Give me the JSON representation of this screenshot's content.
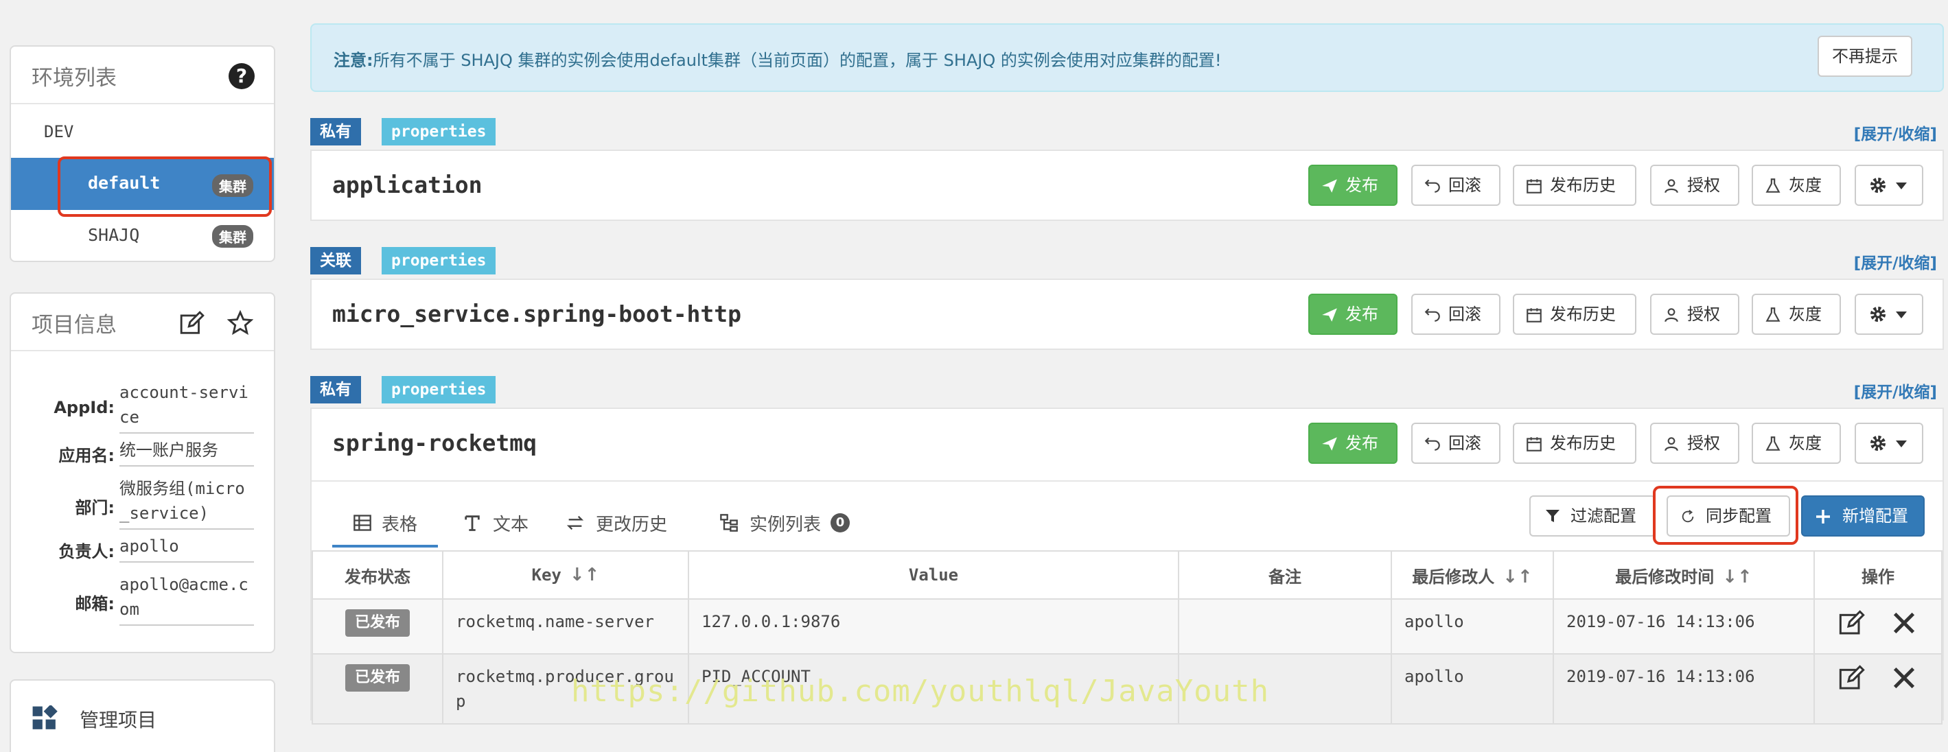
{
  "sidebar": {
    "env_title": "环境列表",
    "env_name": "DEV",
    "clusters": [
      {
        "name": "default",
        "badge": "集群"
      },
      {
        "name": "SHAJQ",
        "badge": "集群"
      }
    ],
    "info_title": "项目信息",
    "info": [
      {
        "label": "AppId:",
        "value": "account-service"
      },
      {
        "label": "应用名:",
        "value": "统一账户服务"
      },
      {
        "label": "部门:",
        "value": "微服务组(micro_service)"
      },
      {
        "label": "负责人:",
        "value": "apollo"
      },
      {
        "label": "邮箱:",
        "value": "apollo@acme.com"
      }
    ],
    "manage_label": "管理项目"
  },
  "notice": {
    "prefix": "注意:",
    "text": "所有不属于 SHAJQ 集群的实例会使用default集群（当前页面）的配置，属于 SHAJQ 的实例会使用对应集群的配置!",
    "dismiss": "不再提示"
  },
  "toggle_label": "[展开/收缩]",
  "actions": {
    "publish": "发布",
    "rollback": "回滚",
    "history": "发布历史",
    "grant": "授权",
    "gray": "灰度"
  },
  "namespaces": [
    {
      "scope": "私有",
      "format": "properties",
      "name": "application"
    },
    {
      "scope": "关联",
      "format": "properties",
      "name": "micro_service.spring-boot-http"
    },
    {
      "scope": "私有",
      "format": "properties",
      "name": "spring-rocketmq"
    }
  ],
  "tabs": {
    "table": "表格",
    "text": "文本",
    "history": "更改历史",
    "instances": "实例列表",
    "instances_count": "0"
  },
  "table_buttons": {
    "filter": "过滤配置",
    "sync": "同步配置",
    "add": "新增配置"
  },
  "table": {
    "headers": {
      "status": "发布状态",
      "key": "Key",
      "value": "Value",
      "comment": "备注",
      "modifier": "最后修改人",
      "time": "最后修改时间",
      "ops": "操作"
    },
    "rows": [
      {
        "status": "已发布",
        "key": "rocketmq.name-server",
        "value": "127.0.0.1:9876",
        "comment": "",
        "modifier": "apollo",
        "time": "2019-07-16 14:13:06"
      },
      {
        "status": "已发布",
        "key": "rocketmq.producer.group",
        "value": "PID_ACCOUNT",
        "comment": "",
        "modifier": "apollo",
        "time": "2019-07-16 14:13:06"
      }
    ]
  },
  "watermark": "https://github.com/youthlql/JavaYouth",
  "colors": {
    "primary": "#3f84c6",
    "success": "#5cb85c",
    "info_bg": "#d9edf7",
    "highlight": "#e0381f"
  }
}
